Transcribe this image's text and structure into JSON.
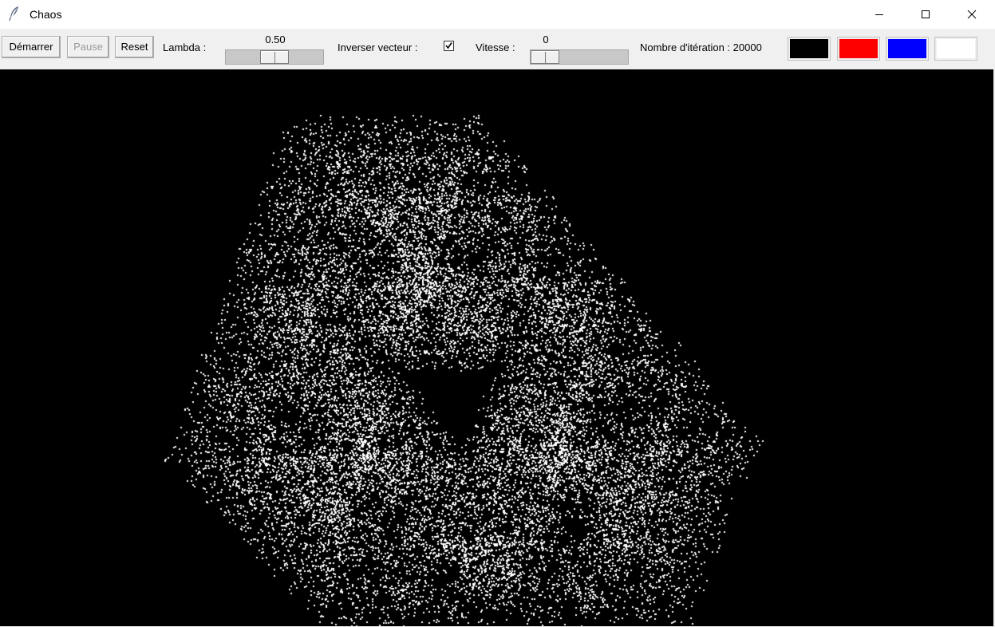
{
  "window": {
    "title": "Chaos",
    "icon": "feather-icon",
    "controls": {
      "minimize_icon": "minimize-icon",
      "maximize_icon": "maximize-icon",
      "close_icon": "close-icon"
    }
  },
  "toolbar": {
    "start_label": "Démarrer",
    "pause_label": "Pause",
    "pause_enabled": false,
    "reset_label": "Reset",
    "lambda_label": "Lambda :",
    "lambda_value": "0.50",
    "lambda_fraction": 0.5,
    "invert_label": "Inverser vecteur :",
    "invert_checked": true,
    "invert_check_glyph": "✓",
    "speed_label": "Vitesse :",
    "speed_value": "0",
    "speed_fraction": 0.0,
    "iterations_label": "Nombre d'itération : 20000",
    "colors": [
      {
        "name": "black",
        "hex": "#000000"
      },
      {
        "name": "red",
        "hex": "#ff0000"
      },
      {
        "name": "blue",
        "hex": "#0000ff"
      },
      {
        "name": "white",
        "hex": "#ffffff"
      }
    ]
  },
  "canvas": {
    "background": "#000000",
    "point_color": "#ffffff",
    "iterations": 20000,
    "lambda": 0.5,
    "inverted": true
  }
}
